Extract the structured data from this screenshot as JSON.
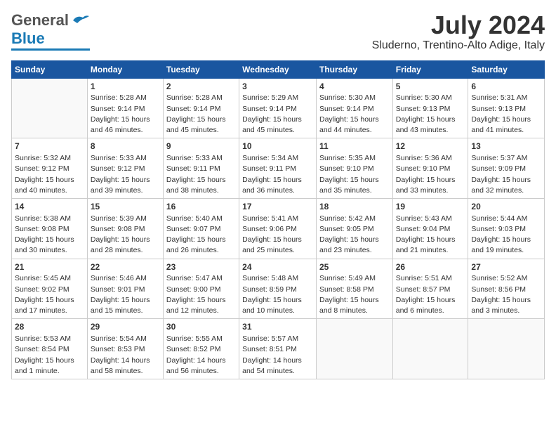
{
  "header": {
    "logo": {
      "general": "General",
      "blue": "Blue"
    },
    "title": "July 2024",
    "location": "Sluderno, Trentino-Alto Adige, Italy"
  },
  "calendar": {
    "days_of_week": [
      "Sunday",
      "Monday",
      "Tuesday",
      "Wednesday",
      "Thursday",
      "Friday",
      "Saturday"
    ],
    "weeks": [
      [
        {
          "day": "",
          "info": ""
        },
        {
          "day": "1",
          "info": "Sunrise: 5:28 AM\nSunset: 9:14 PM\nDaylight: 15 hours\nand 46 minutes."
        },
        {
          "day": "2",
          "info": "Sunrise: 5:28 AM\nSunset: 9:14 PM\nDaylight: 15 hours\nand 45 minutes."
        },
        {
          "day": "3",
          "info": "Sunrise: 5:29 AM\nSunset: 9:14 PM\nDaylight: 15 hours\nand 45 minutes."
        },
        {
          "day": "4",
          "info": "Sunrise: 5:30 AM\nSunset: 9:14 PM\nDaylight: 15 hours\nand 44 minutes."
        },
        {
          "day": "5",
          "info": "Sunrise: 5:30 AM\nSunset: 9:13 PM\nDaylight: 15 hours\nand 43 minutes."
        },
        {
          "day": "6",
          "info": "Sunrise: 5:31 AM\nSunset: 9:13 PM\nDaylight: 15 hours\nand 41 minutes."
        }
      ],
      [
        {
          "day": "7",
          "info": "Sunrise: 5:32 AM\nSunset: 9:12 PM\nDaylight: 15 hours\nand 40 minutes."
        },
        {
          "day": "8",
          "info": "Sunrise: 5:33 AM\nSunset: 9:12 PM\nDaylight: 15 hours\nand 39 minutes."
        },
        {
          "day": "9",
          "info": "Sunrise: 5:33 AM\nSunset: 9:11 PM\nDaylight: 15 hours\nand 38 minutes."
        },
        {
          "day": "10",
          "info": "Sunrise: 5:34 AM\nSunset: 9:11 PM\nDaylight: 15 hours\nand 36 minutes."
        },
        {
          "day": "11",
          "info": "Sunrise: 5:35 AM\nSunset: 9:10 PM\nDaylight: 15 hours\nand 35 minutes."
        },
        {
          "day": "12",
          "info": "Sunrise: 5:36 AM\nSunset: 9:10 PM\nDaylight: 15 hours\nand 33 minutes."
        },
        {
          "day": "13",
          "info": "Sunrise: 5:37 AM\nSunset: 9:09 PM\nDaylight: 15 hours\nand 32 minutes."
        }
      ],
      [
        {
          "day": "14",
          "info": "Sunrise: 5:38 AM\nSunset: 9:08 PM\nDaylight: 15 hours\nand 30 minutes."
        },
        {
          "day": "15",
          "info": "Sunrise: 5:39 AM\nSunset: 9:08 PM\nDaylight: 15 hours\nand 28 minutes."
        },
        {
          "day": "16",
          "info": "Sunrise: 5:40 AM\nSunset: 9:07 PM\nDaylight: 15 hours\nand 26 minutes."
        },
        {
          "day": "17",
          "info": "Sunrise: 5:41 AM\nSunset: 9:06 PM\nDaylight: 15 hours\nand 25 minutes."
        },
        {
          "day": "18",
          "info": "Sunrise: 5:42 AM\nSunset: 9:05 PM\nDaylight: 15 hours\nand 23 minutes."
        },
        {
          "day": "19",
          "info": "Sunrise: 5:43 AM\nSunset: 9:04 PM\nDaylight: 15 hours\nand 21 minutes."
        },
        {
          "day": "20",
          "info": "Sunrise: 5:44 AM\nSunset: 9:03 PM\nDaylight: 15 hours\nand 19 minutes."
        }
      ],
      [
        {
          "day": "21",
          "info": "Sunrise: 5:45 AM\nSunset: 9:02 PM\nDaylight: 15 hours\nand 17 minutes."
        },
        {
          "day": "22",
          "info": "Sunrise: 5:46 AM\nSunset: 9:01 PM\nDaylight: 15 hours\nand 15 minutes."
        },
        {
          "day": "23",
          "info": "Sunrise: 5:47 AM\nSunset: 9:00 PM\nDaylight: 15 hours\nand 12 minutes."
        },
        {
          "day": "24",
          "info": "Sunrise: 5:48 AM\nSunset: 8:59 PM\nDaylight: 15 hours\nand 10 minutes."
        },
        {
          "day": "25",
          "info": "Sunrise: 5:49 AM\nSunset: 8:58 PM\nDaylight: 15 hours\nand 8 minutes."
        },
        {
          "day": "26",
          "info": "Sunrise: 5:51 AM\nSunset: 8:57 PM\nDaylight: 15 hours\nand 6 minutes."
        },
        {
          "day": "27",
          "info": "Sunrise: 5:52 AM\nSunset: 8:56 PM\nDaylight: 15 hours\nand 3 minutes."
        }
      ],
      [
        {
          "day": "28",
          "info": "Sunrise: 5:53 AM\nSunset: 8:54 PM\nDaylight: 15 hours\nand 1 minute."
        },
        {
          "day": "29",
          "info": "Sunrise: 5:54 AM\nSunset: 8:53 PM\nDaylight: 14 hours\nand 58 minutes."
        },
        {
          "day": "30",
          "info": "Sunrise: 5:55 AM\nSunset: 8:52 PM\nDaylight: 14 hours\nand 56 minutes."
        },
        {
          "day": "31",
          "info": "Sunrise: 5:57 AM\nSunset: 8:51 PM\nDaylight: 14 hours\nand 54 minutes."
        },
        {
          "day": "",
          "info": ""
        },
        {
          "day": "",
          "info": ""
        },
        {
          "day": "",
          "info": ""
        }
      ]
    ]
  }
}
